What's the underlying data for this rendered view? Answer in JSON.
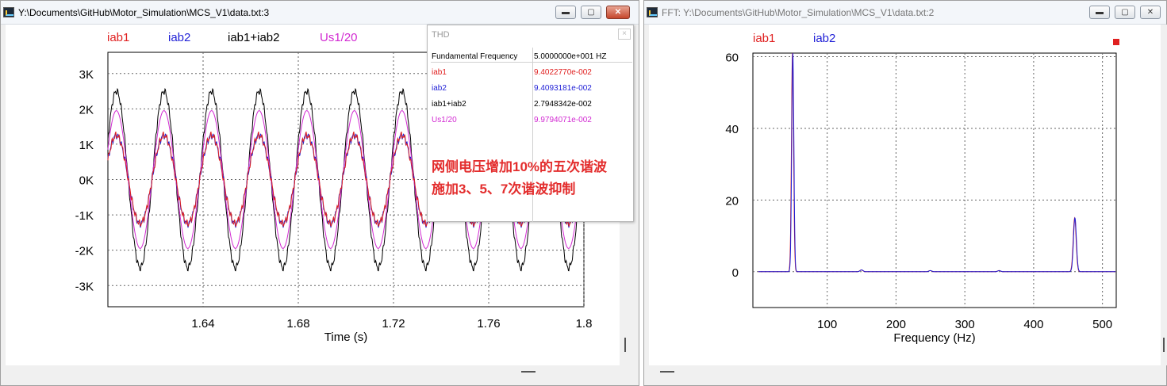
{
  "left_window": {
    "title": "Y:\\Documents\\GitHub\\Motor_Simulation\\MCS_V1\\data.txt:3",
    "controls": {
      "minimize": "▬",
      "maximize": "▢",
      "close": "✕"
    }
  },
  "right_window": {
    "title": "FFT:  Y:\\Documents\\GitHub\\Motor_Simulation\\MCS_V1\\data.txt:2",
    "controls": {
      "minimize": "▬",
      "maximize": "▢",
      "close": "✕"
    }
  },
  "colors": {
    "iab1": "#e02020",
    "iab2": "#1f1fd6",
    "sum": "#000000",
    "us": "#d22ad2"
  },
  "chart_data": [
    {
      "type": "line",
      "title": "",
      "xlabel": "Time (s)",
      "ylabel": "",
      "xlim": [
        1.6,
        1.8
      ],
      "ylim": [
        -3.6,
        3.6
      ],
      "x_ticks": [
        1.64,
        1.68,
        1.72,
        1.76,
        1.8
      ],
      "x_tick_labels": [
        "1.64",
        "1.68",
        "1.72",
        "1.76",
        "1.8"
      ],
      "y_ticks": [
        3,
        2,
        1,
        0,
        -1,
        -2,
        -3
      ],
      "y_tick_labels": [
        "3K",
        "2K",
        "1K",
        "0K",
        "-1K",
        "-2K",
        "-3K"
      ],
      "y_unit_scale": 1000,
      "frequency_hz": 50,
      "grid": true,
      "legend_position": "top",
      "series": [
        {
          "name": "iab1",
          "amplitude": 1.25,
          "color": "#e02020"
        },
        {
          "name": "iab2",
          "amplitude": 1.25,
          "color": "#1f1fd6"
        },
        {
          "name": "iab1+iab2",
          "amplitude": 2.5,
          "color": "#000000"
        },
        {
          "name": "Us1/20",
          "amplitude": 1.95,
          "color": "#d22ad2"
        }
      ]
    },
    {
      "type": "line",
      "title": "",
      "xlabel": "Frequency (Hz)",
      "ylabel": "",
      "xlim": [
        -8,
        520
      ],
      "ylim": [
        -10,
        61
      ],
      "x_ticks": [
        100,
        200,
        300,
        400,
        500
      ],
      "x_tick_labels": [
        "100",
        "200",
        "300",
        "400",
        "500"
      ],
      "y_ticks": [
        60,
        40,
        20,
        0
      ],
      "y_tick_labels": [
        "60",
        "40",
        "20",
        "0"
      ],
      "grid": true,
      "legend_position": "top",
      "series": [
        {
          "name": "iab1",
          "color": "#e02020"
        },
        {
          "name": "iab2",
          "color": "#1f1fd6"
        }
      ],
      "peaks": [
        {
          "hz": 50,
          "value": 61
        },
        {
          "hz": 150,
          "value": 0.5
        },
        {
          "hz": 250,
          "value": 0.3
        },
        {
          "hz": 350,
          "value": 0.3
        },
        {
          "hz": 460,
          "value": 15
        }
      ]
    }
  ],
  "thd": {
    "title": "THD",
    "close": "×",
    "header_label": "Fundamental Frequency",
    "header_value": "5.0000000e+001 HZ",
    "rows": [
      {
        "name": "iab1",
        "value": "9.4022770e-002",
        "color": "#e02020"
      },
      {
        "name": "iab2",
        "value": "9.4093181e-002",
        "color": "#1f1fd6"
      },
      {
        "name": "iab1+iab2",
        "value": "2.7948342e-002",
        "color": "#000000"
      },
      {
        "name": "Us1/20",
        "value": "9.9794071e-002",
        "color": "#d22ad2"
      }
    ],
    "note_line1": "网侧电压增加10%的五次谐波",
    "note_line2": "施加3、5、7次谐波抑制"
  }
}
